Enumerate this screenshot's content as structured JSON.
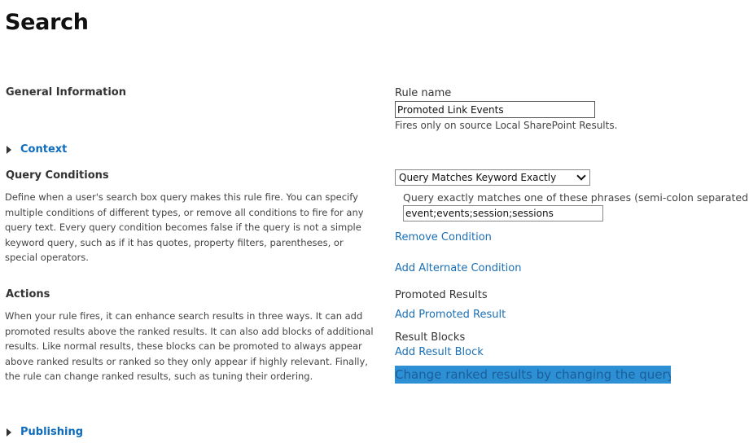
{
  "page": {
    "title": "Search"
  },
  "general": {
    "heading": "General Information",
    "rule_name_label": "Rule name",
    "rule_name_value": "Promoted Link Events",
    "source_note": "Fires only on source Local SharePoint Results."
  },
  "context": {
    "label": "Context",
    "icon": "triangle-right-icon"
  },
  "query_conditions": {
    "heading": "Query Conditions",
    "description": "Define when a user's search box query makes this rule fire. You can specify multiple conditions of different types, or remove all conditions to fire for any query text. Every query condition becomes false if the query is not a simple keyword query, such as if it has quotes, property filters, parentheses, or special operators.",
    "condition_type": "Query Matches Keyword Exactly",
    "phrases_label": "Query exactly matches one of these phrases (semi-colon separated)",
    "phrases_value": "event;events;session;sessions",
    "remove_link": "Remove Condition",
    "add_alternate_link": "Add Alternate Condition"
  },
  "actions": {
    "heading": "Actions",
    "description": "When your rule fires, it can enhance search results in three ways. It can add promoted results above the ranked results. It can also add blocks of additional results. Like normal results, these blocks can be promoted to always appear above ranked results or ranked so they only appear if highly relevant. Finally, the rule can change ranked results, such as tuning their ordering.",
    "promoted_label": "Promoted Results",
    "add_promoted_link": "Add Promoted Result",
    "blocks_label": "Result Blocks",
    "add_block_link": "Add Result Block",
    "change_ranked_link": "Change ranked results by changing the query"
  },
  "publishing": {
    "label": "Publishing",
    "icon": "triangle-right-icon"
  },
  "colors": {
    "link": "#1a6fb5",
    "expander": "#0f6cbd",
    "selection_highlight": "#2d8fd4"
  }
}
